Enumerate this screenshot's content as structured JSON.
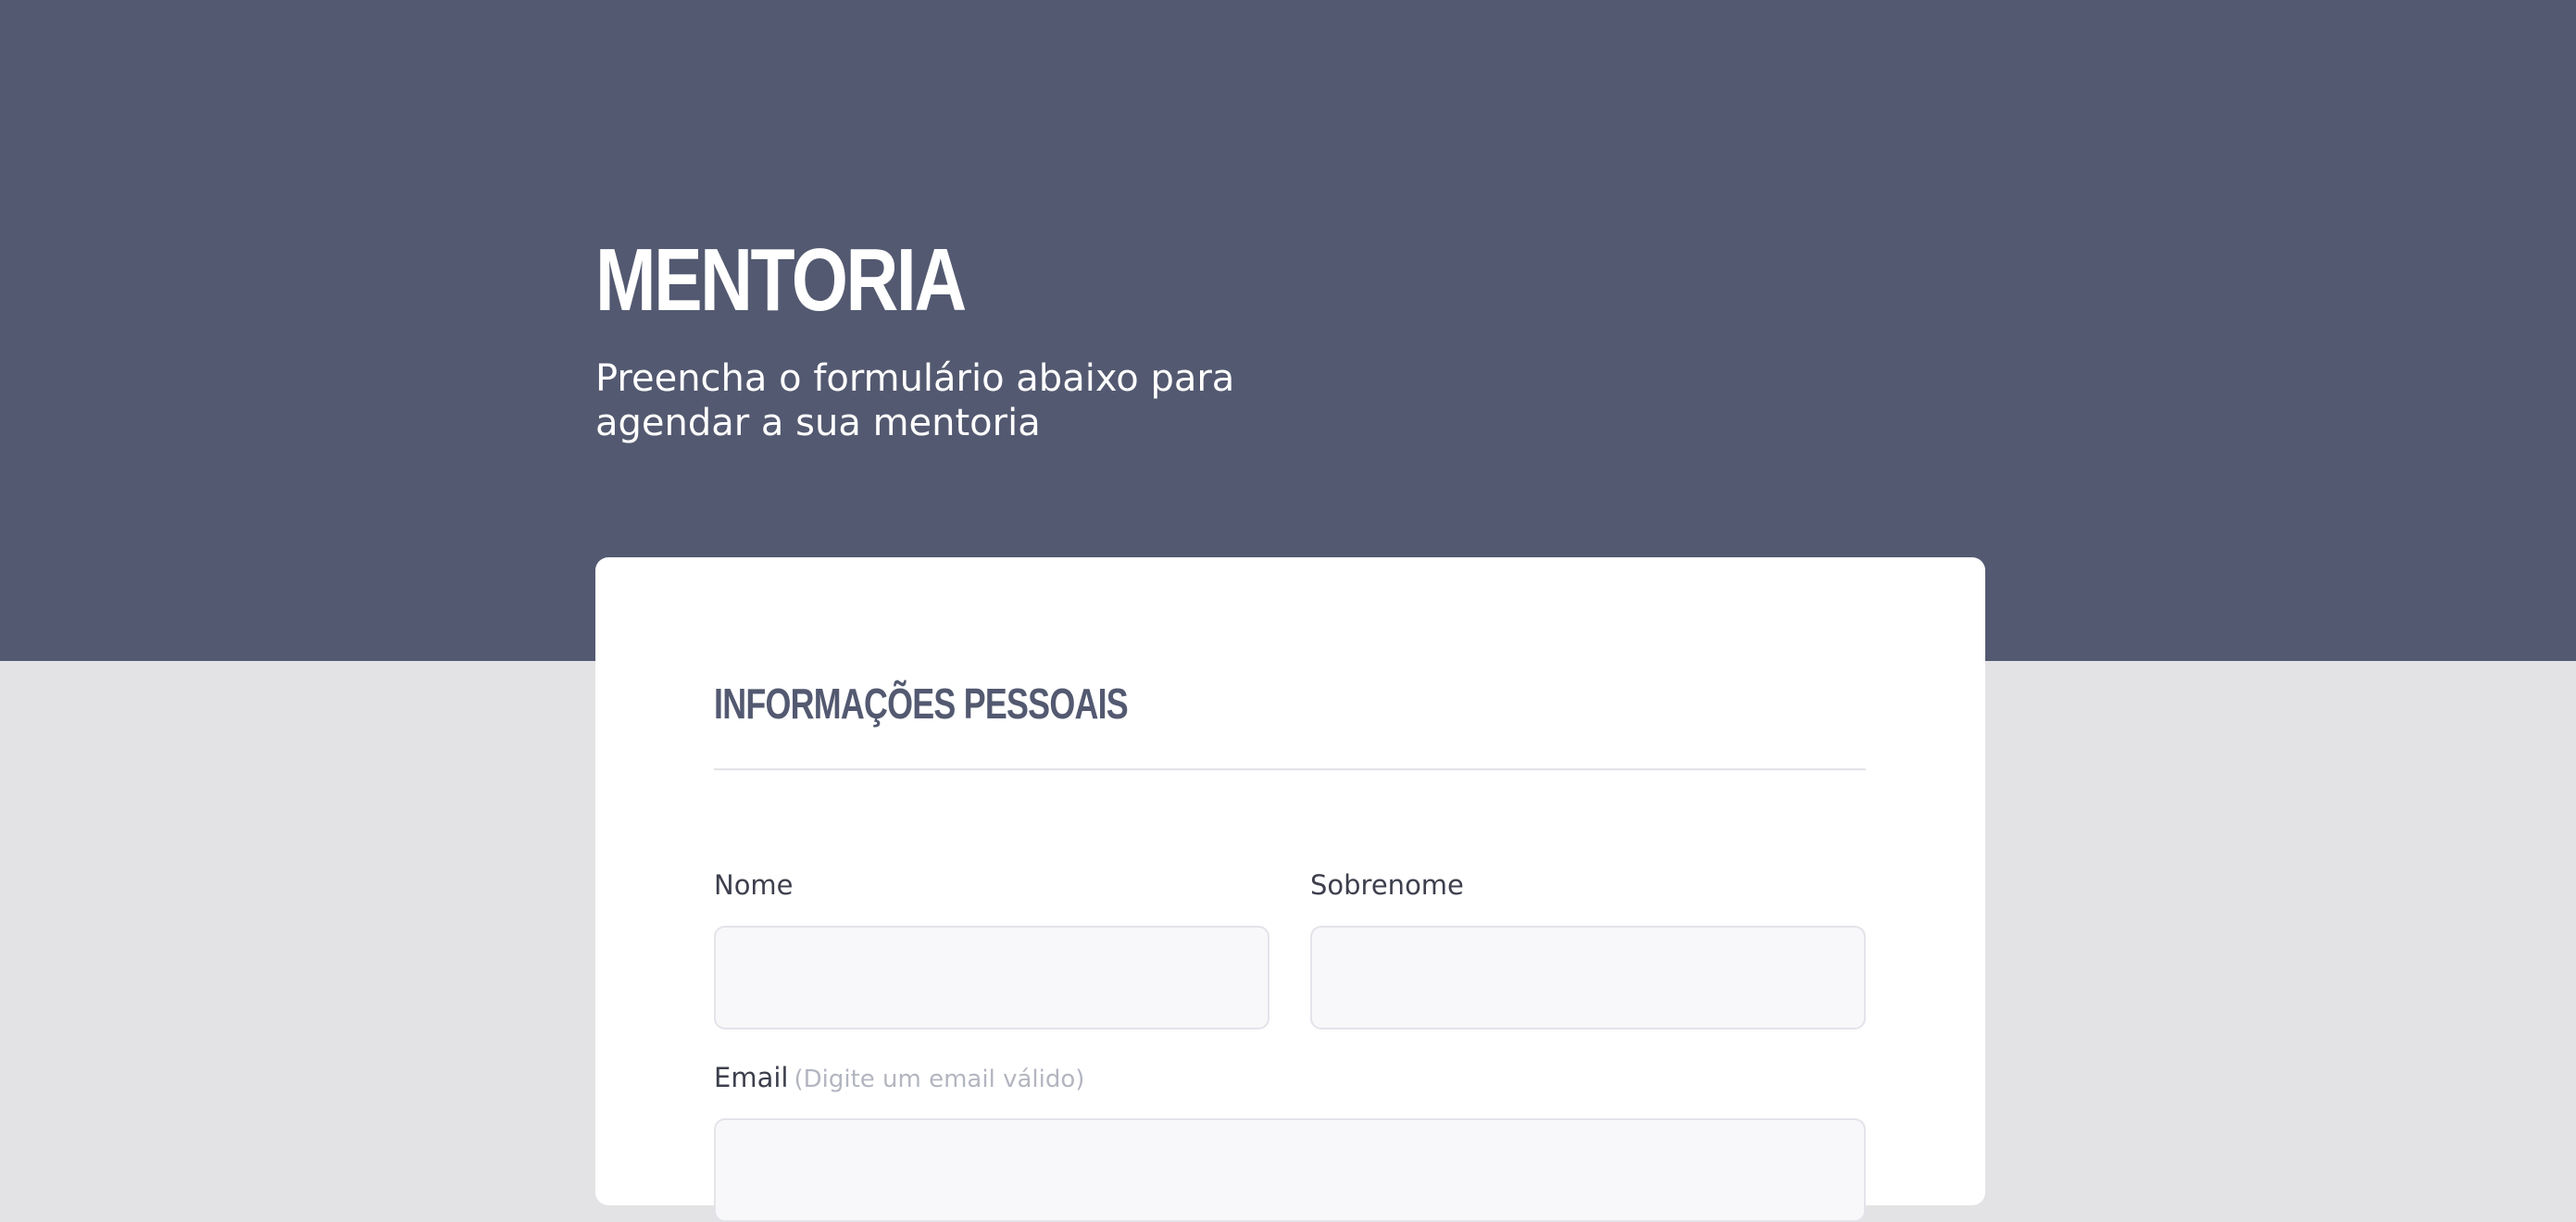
{
  "header": {
    "title": "MENTORIA",
    "subtitle": "Preencha o formulário abaixo para agendar a sua mentoria"
  },
  "form": {
    "section_title": "INFORMAÇÕES PESSOAIS",
    "fields": {
      "first_name": {
        "label": "Nome",
        "value": "",
        "placeholder": ""
      },
      "last_name": {
        "label": "Sobrenome",
        "value": "",
        "placeholder": ""
      },
      "email": {
        "label": "Email",
        "hint": "(Digite um email válido)",
        "value": "",
        "placeholder": ""
      }
    }
  },
  "colors": {
    "hero_background": "#535970",
    "page_background": "#e3e3e5",
    "card_background": "#ffffff",
    "section_title": "#535970",
    "input_background": "#f8f8fa",
    "input_border": "#e3e4ea",
    "hint_text": "#b3b5c0"
  }
}
